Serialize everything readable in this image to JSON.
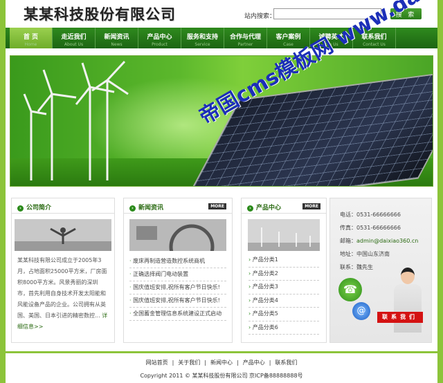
{
  "header": {
    "logo": "某某科技股份有限公司",
    "search_label": "站内搜索：",
    "search_placeholder": "",
    "search_button": "搜 索"
  },
  "nav": [
    {
      "cn": "首 页",
      "en": "Home",
      "active": true
    },
    {
      "cn": "走近我们",
      "en": "About Us"
    },
    {
      "cn": "新闻资讯",
      "en": "News"
    },
    {
      "cn": "产品中心",
      "en": "Product"
    },
    {
      "cn": "服务和支持",
      "en": "Service"
    },
    {
      "cn": "合作与代理",
      "en": "Partner"
    },
    {
      "cn": "客户案例",
      "en": "Case"
    },
    {
      "cn": "诚聘英才",
      "en": "Join Us"
    },
    {
      "cn": "联系我们",
      "en": "Contact Us"
    }
  ],
  "banner": {
    "watermark": "帝国cms模板网 www.daixiao360.cn"
  },
  "about": {
    "title": "公司简介",
    "text": "某某科技有限公司成立于2005年3月，占地面积25000平方米，厂房面积8000平方米。风景秀丽的深圳市，首先利用自身技术开发太阳能和风能设备产品的企业。公司拥有从英国、美国、日本引进的精密数控...",
    "more": "详细信息>>"
  },
  "news": {
    "title": "新闻资讯",
    "more": "MORE",
    "items": [
      "废床再制造营造数控系统商机",
      "正确选择阀门电动装置",
      "国庆值班安排,祝所有客户节日快乐!",
      "国庆值班安排,祝所有客户节日快乐!",
      "全国蓄金管理信息系统建设正式启动"
    ]
  },
  "products": {
    "title": "产品中心",
    "more": "MORE",
    "items": [
      "产品分类1",
      "产品分类2",
      "产品分类3",
      "产品分类4",
      "产品分类5",
      "产品分类6"
    ]
  },
  "contact": {
    "phone": "电话：0531-66666666",
    "fax": "传真：0531-66666666",
    "email_label": "邮箱：",
    "email": "admin@daixiao360.cn",
    "address": "地址：中国山东济南",
    "person": "联系：魏先生",
    "cta": "联系我们"
  },
  "footer": {
    "links": [
      "网站首页",
      "关于我们",
      "新闻中心",
      "产品中心",
      "联系我们"
    ],
    "copyright": "Copyright 2011 © 某某科技股份有限公司    京ICP备88888888号"
  }
}
